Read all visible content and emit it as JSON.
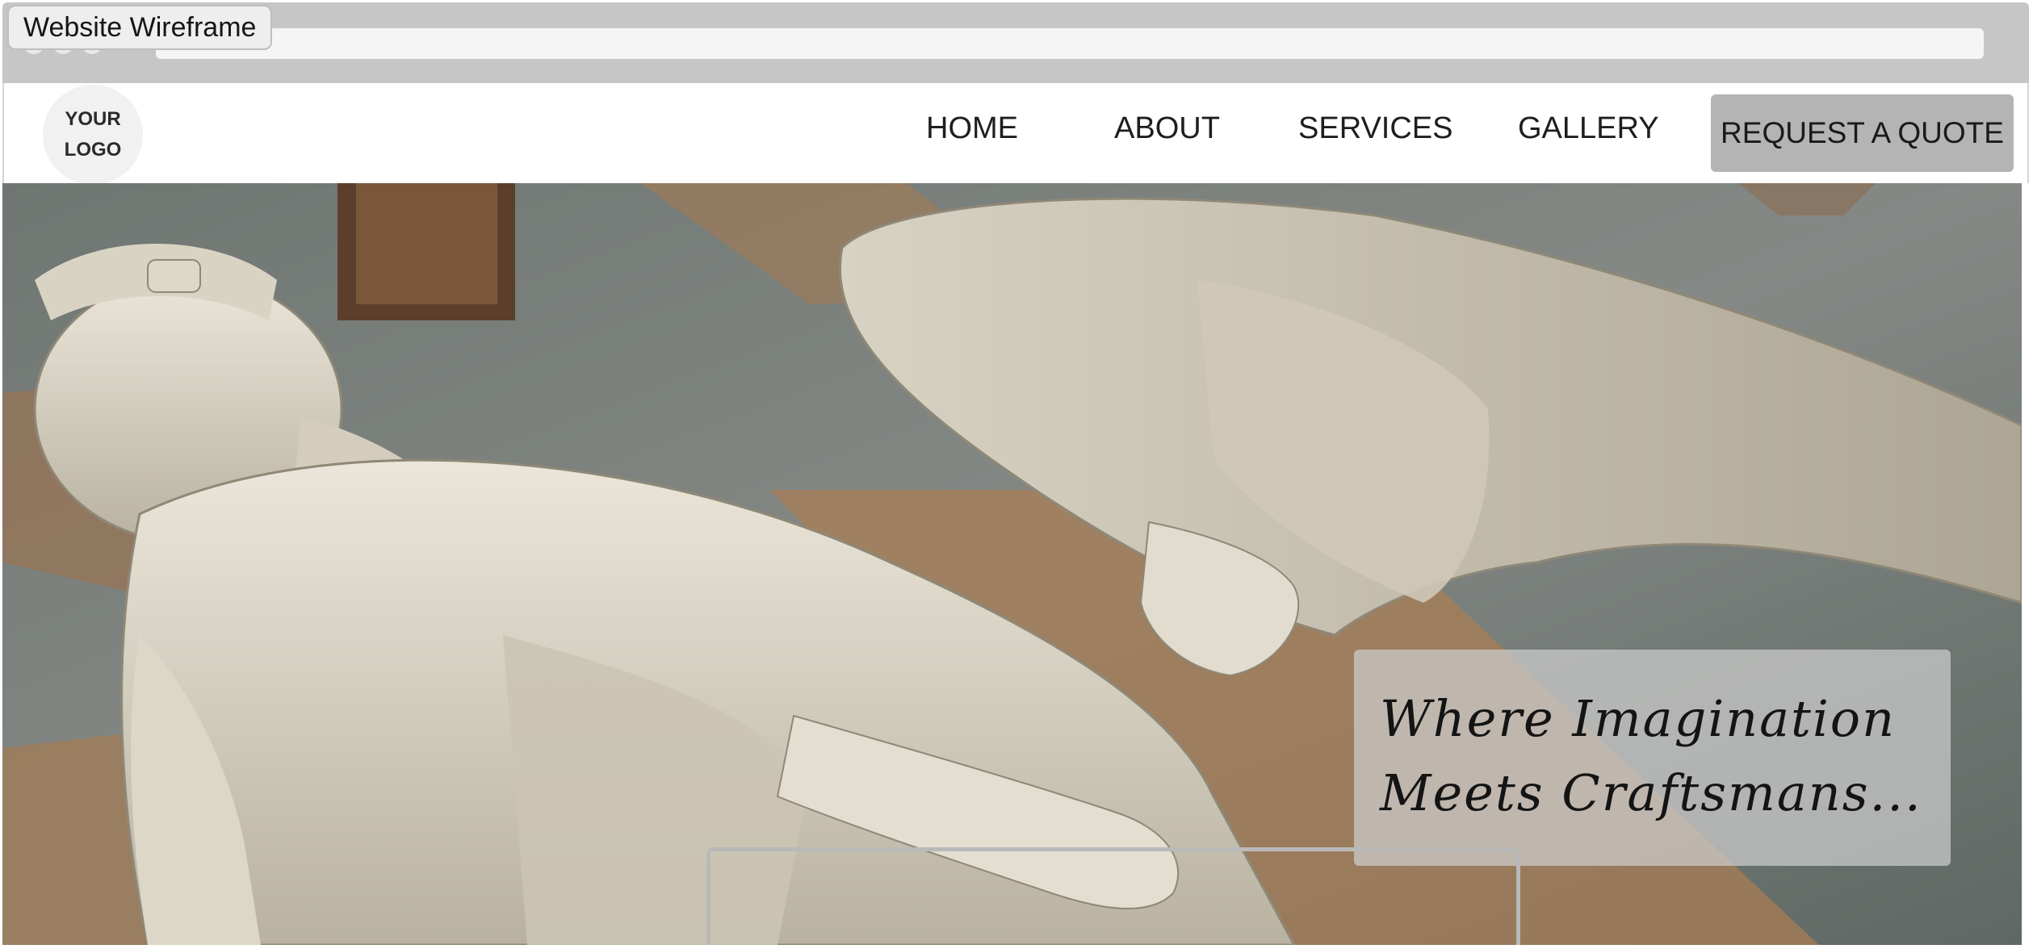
{
  "window": {
    "title": "Website Wireframe"
  },
  "header": {
    "logo_text": "YOUR LOGO",
    "nav": [
      {
        "label": "HOME"
      },
      {
        "label": "ABOUT"
      },
      {
        "label": "SERVICES"
      },
      {
        "label": "GALLERY"
      }
    ],
    "cta_label": "REQUEST A QUOTE"
  },
  "hero": {
    "image_subject": "two carved stone Egyptian pharaoh statues lying on wooden boards",
    "tagline": "Where Imagination\nMeets Craftsmans..."
  },
  "colors": {
    "chrome": "#c6c6c6",
    "cta_background": "#b4b4b4",
    "tagline_box": "rgba(205,205,205,0.72)"
  }
}
